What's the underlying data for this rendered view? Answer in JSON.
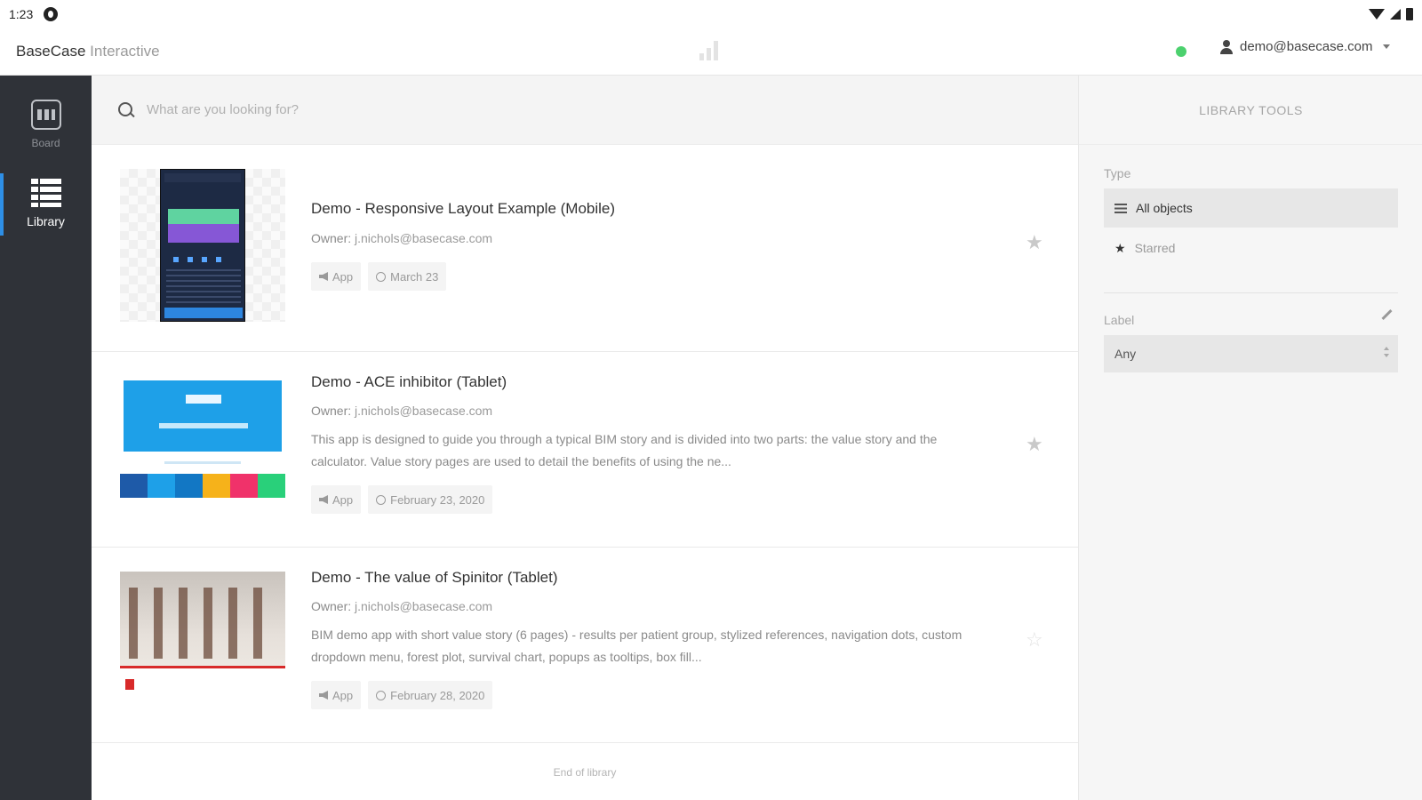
{
  "status_bar": {
    "time": "1:23"
  },
  "header": {
    "brand_name": "BaseCase",
    "brand_suffix": "Interactive",
    "user_email": "demo@basecase.com",
    "online_color": "#4cd16e"
  },
  "sidebar": {
    "items": [
      {
        "label": "Board",
        "icon": "board-icon",
        "active": false
      },
      {
        "label": "Library",
        "icon": "library-icon",
        "active": true
      }
    ]
  },
  "search": {
    "placeholder": "What are you looking for?",
    "value": ""
  },
  "library": {
    "items": [
      {
        "title": "Demo - Responsive Layout Example (Mobile)",
        "owner_label": "Owner:",
        "owner": "j.nichols@basecase.com",
        "description": "",
        "type_tag": "App",
        "date_tag": "March 23",
        "starred": true
      },
      {
        "title": "Demo - ACE inhibitor (Tablet)",
        "owner_label": "Owner:",
        "owner": "j.nichols@basecase.com",
        "description": "This app is designed to guide you through a typical BIM story and is divided into two parts: the value story and the calculator. Value story pages are used to detail the benefits of using the ne...",
        "type_tag": "App",
        "date_tag": "February 23, 2020",
        "starred": true
      },
      {
        "title": "Demo - The value of Spinitor (Tablet)",
        "owner_label": "Owner:",
        "owner": "j.nichols@basecase.com",
        "description": "BIM demo app with short value story (6 pages) - results per patient group, stylized references, navigation dots, custom dropdown menu, forest plot, survival chart, popups as tooltips, box fill...",
        "type_tag": "App",
        "date_tag": "February 28, 2020",
        "starred": false
      }
    ],
    "end_label": "End of library"
  },
  "tools": {
    "title": "LIBRARY TOOLS",
    "type_label": "Type",
    "filters": [
      {
        "label": "All objects",
        "icon": "list-icon",
        "active": true
      },
      {
        "label": "Starred",
        "icon": "star-icon",
        "active": false
      }
    ],
    "label_label": "Label",
    "label_select_value": "Any"
  },
  "colors": {
    "sidebar_bg": "#2f3238",
    "accent": "#2e8fe6",
    "panel_bg": "#f6f6f6"
  }
}
